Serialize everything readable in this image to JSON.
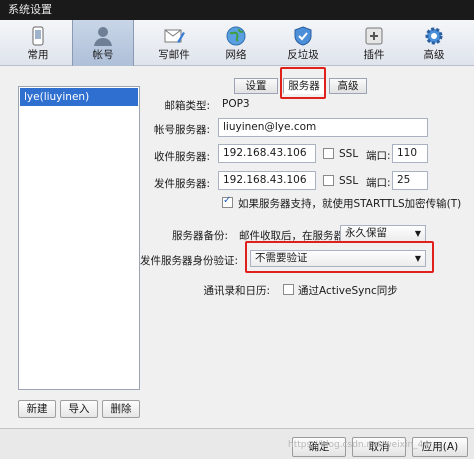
{
  "window": {
    "title": "系统设置"
  },
  "toolbar": {
    "items": [
      {
        "label": "常用",
        "icon": "phone-icon"
      },
      {
        "label": "帐号",
        "icon": "user-icon"
      },
      {
        "label": "写邮件",
        "icon": "compose-icon"
      },
      {
        "label": "网络",
        "icon": "globe-icon"
      },
      {
        "label": "反垃圾",
        "icon": "shield-icon"
      },
      {
        "label": "插件",
        "icon": "plugin-icon"
      },
      {
        "label": "高级",
        "icon": "gear-icon"
      }
    ],
    "active": "帐号"
  },
  "accounts": {
    "items": [
      "lye(liuyinen)"
    ],
    "buttons": {
      "new": "新建",
      "import": "导入",
      "delete": "删除"
    }
  },
  "tabs": {
    "settings": "设置",
    "server": "服务器",
    "advanced": "高级",
    "active": "服务器"
  },
  "form": {
    "mailbox_type_label": "邮箱类型:",
    "mailbox_type_value": "POP3",
    "account_server_label": "帐号服务器:",
    "account_server_value": "liuyinen@lye.com",
    "incoming_label": "收件服务器:",
    "incoming_value": "192.168.43.106",
    "incoming_ssl_label": "SSL",
    "incoming_ssl_checked": false,
    "incoming_port_label": "端口:",
    "incoming_port_value": "110",
    "outgoing_label": "发件服务器:",
    "outgoing_value": "192.168.43.106",
    "outgoing_ssl_label": "SSL",
    "outgoing_ssl_checked": false,
    "outgoing_port_label": "端口:",
    "outgoing_port_value": "25",
    "starttls_label": "如果服务器支持，就使用STARTTLS加密传输(T)",
    "starttls_checked": true,
    "backup_label": "服务器备份:",
    "backup_desc": "邮件收取后，在服务器上",
    "backup_value": "永久保留",
    "smtp_auth_label": "发件服务器身份验证:",
    "smtp_auth_value": "不需要验证",
    "contacts_label": "通讯录和日历:",
    "activesync_label": "通过ActiveSync同步",
    "activesync_checked": false
  },
  "footer": {
    "ok": "确定",
    "cancel": "取消",
    "apply": "应用(A)"
  },
  "watermark": "https://blog.csdn.net/weixin_44..."
}
